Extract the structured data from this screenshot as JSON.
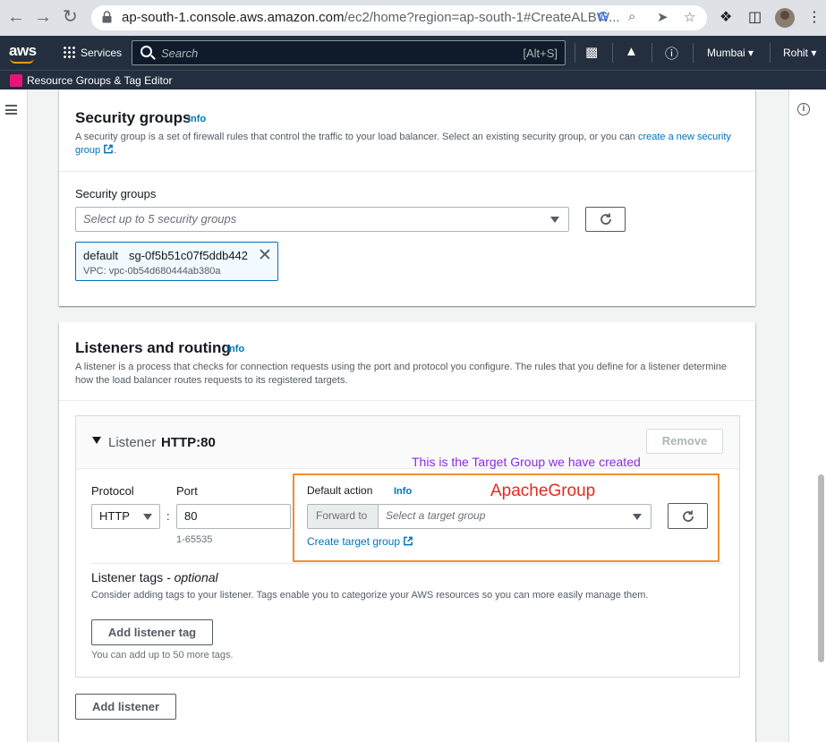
{
  "browser": {
    "url_host": "ap-south-1.console.aws.amazon.com",
    "url_path": "/ec2/home?region=ap-south-1#CreateALBW..."
  },
  "aws_nav": {
    "logo": "aws",
    "services": "Services",
    "search_placeholder": "Search",
    "search_shortcut": "[Alt+S]",
    "region": "Mumbai",
    "user": "Rohit"
  },
  "resource_bar": {
    "label": "Resource Groups & Tag Editor"
  },
  "security_groups": {
    "title": "Security groups",
    "info": "Info",
    "description_prefix": "A security group is a set of firewall rules that control the traffic to your load balancer. Select an existing security group, or you can ",
    "description_link": "create a new security group",
    "description_suffix": ".",
    "field_label": "Security groups",
    "select_placeholder": "Select up to 5 security groups",
    "token": {
      "name": "default",
      "id": "sg-0f5b51c07f5ddb442",
      "vpc": "VPC: vpc-0b54d680444ab380a"
    }
  },
  "listeners": {
    "title": "Listeners and routing",
    "info": "Info",
    "description": "A listener is a process that checks for connection requests using the port and protocol you configure. The rules that you define for a listener determine how the load balancer routes requests to its registered targets.",
    "listener": {
      "header_prefix": "Listener",
      "header_name": "HTTP:80",
      "remove": "Remove",
      "protocol_label": "Protocol",
      "protocol_value": "HTTP",
      "colon": ":",
      "port_label": "Port",
      "port_value": "80",
      "port_hint": "1-65535",
      "default_action_label": "Default action",
      "default_action_info": "Info",
      "forward_to": "Forward to",
      "target_placeholder": "Select a target group",
      "create_target_group": "Create target group",
      "tags_title": "Listener tags",
      "tags_optional": "- optional",
      "tags_description": "Consider adding tags to your listener. Tags enable you to categorize your AWS resources so you can more easily manage them.",
      "add_tag_button": "Add listener tag",
      "tag_hint": "You can add up to 50 more tags."
    },
    "add_listener_button": "Add listener"
  },
  "annotations": {
    "note": "This is the Target Group we have created",
    "group_name": "ApacheGroup",
    "note_color": "#8a2be2",
    "group_color": "#e8291c",
    "box_color": "#f0902f"
  }
}
